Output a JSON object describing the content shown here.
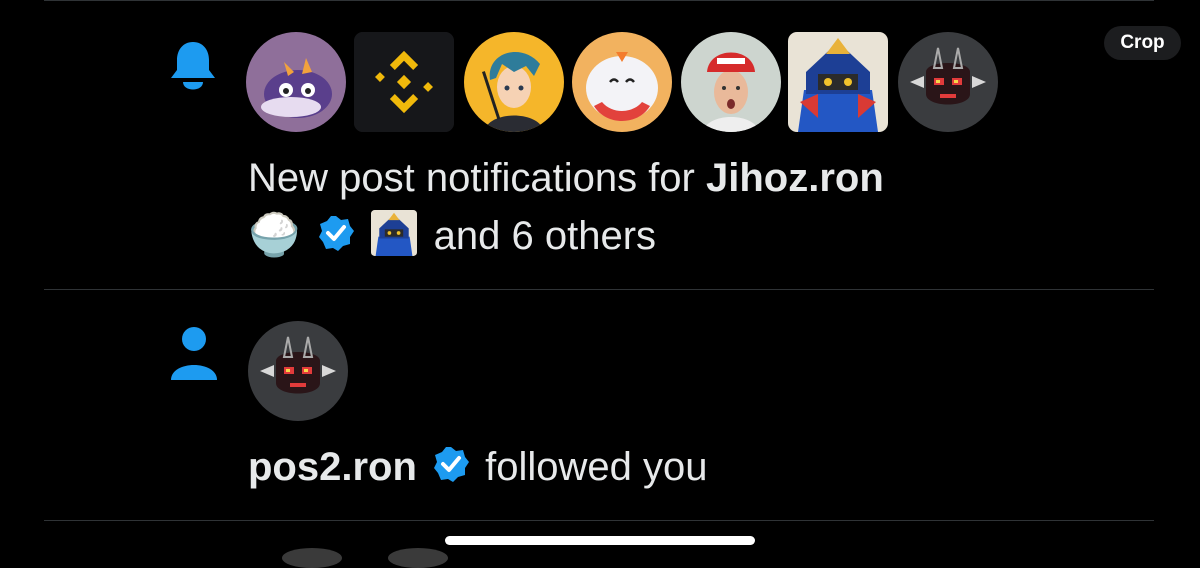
{
  "crop_button": {
    "label": "Crop"
  },
  "notification_1": {
    "icon": "bell-icon",
    "text_prefix": "New post notifications for",
    "username": "Jihoz.ron",
    "emoji": "🍚",
    "suffix": "and 6 others",
    "avatars": [
      "purple-creature-avatar",
      "binance-logo-avatar",
      "anime-character-avatar",
      "axie-creature-avatar",
      "person-red-cap-avatar",
      "samurai-robot-avatar",
      "pixel-mask-avatar"
    ]
  },
  "notification_2": {
    "icon": "person-icon",
    "username": "pos2.ron",
    "action": "followed you",
    "avatar": "pixel-mask-avatar"
  },
  "colors": {
    "background": "#000000",
    "accent": "#1d9bf0",
    "text": "#e7e9ea",
    "divider": "#2f3336"
  }
}
